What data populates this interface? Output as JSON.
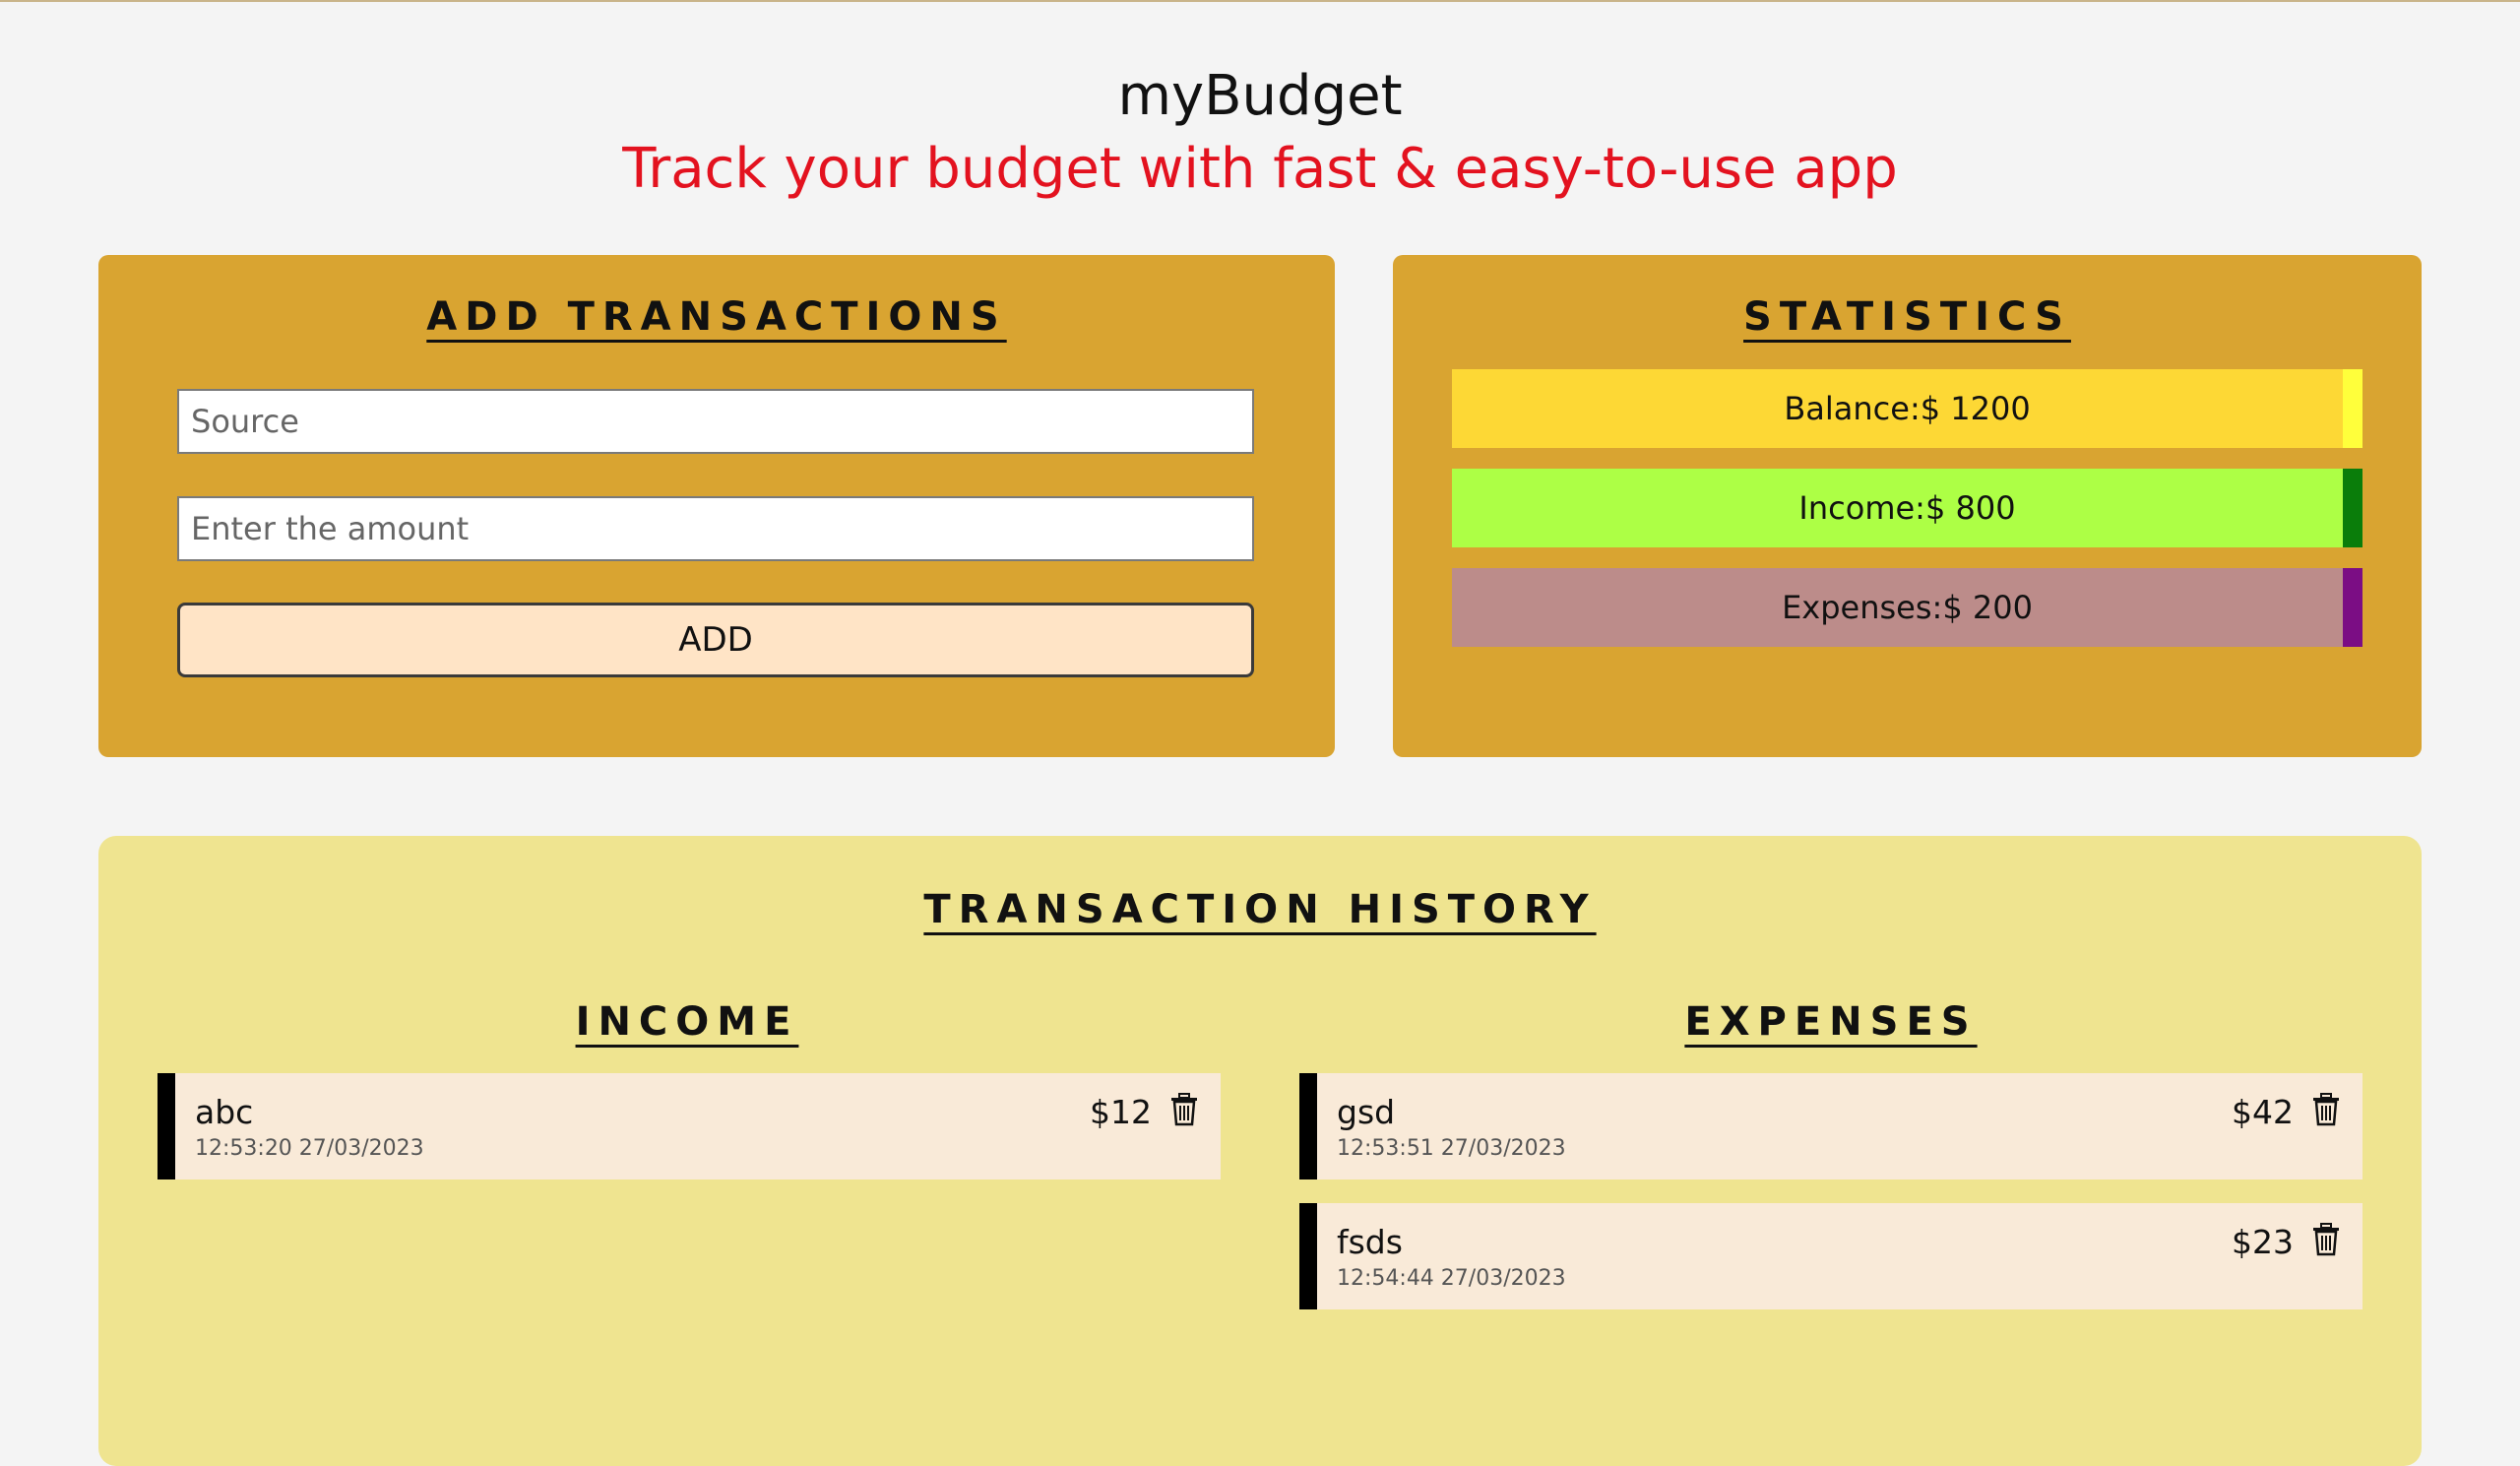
{
  "header": {
    "title": "myBudget",
    "tagline": "Track your budget with fast & easy-to-use app"
  },
  "add_transactions": {
    "title": "ADD TRANSACTIONS",
    "source_placeholder": "Source",
    "source_value": "",
    "amount_placeholder": "Enter the amount",
    "amount_value": "",
    "add_label": "ADD"
  },
  "statistics": {
    "title": "STATISTICS",
    "balance_label": "Balance:$ 1200",
    "income_label": "Income:$ 800",
    "expenses_label": "Expenses:$ 200",
    "colors": {
      "balance_bg": "#fdd835",
      "balance_edge": "#ffff3b",
      "income_bg": "#adff45",
      "income_edge": "#0a7d0a",
      "expenses_bg": "#bc8c8a",
      "expenses_edge": "#7b0d84"
    }
  },
  "history": {
    "title": "TRANSACTION HISTORY",
    "income_title": "INCOME",
    "expenses_title": "EXPENSES",
    "income": [
      {
        "source": "abc",
        "time": "12:53:20 27/03/2023",
        "amount": "$12",
        "icon": "trash-icon"
      }
    ],
    "expenses": [
      {
        "source": "gsd",
        "time": "12:53:51 27/03/2023",
        "amount": "$42",
        "icon": "trash-icon"
      },
      {
        "source": "fsds",
        "time": "12:54:44 27/03/2023",
        "amount": "$23",
        "icon": "trash-icon"
      }
    ]
  },
  "colors": {
    "page_bg": "#f4f4f4",
    "panel_bg": "#d9a431",
    "history_bg": "#efe490",
    "tagline": "#e3121f",
    "tx_item_bg": "#f9ead8"
  }
}
